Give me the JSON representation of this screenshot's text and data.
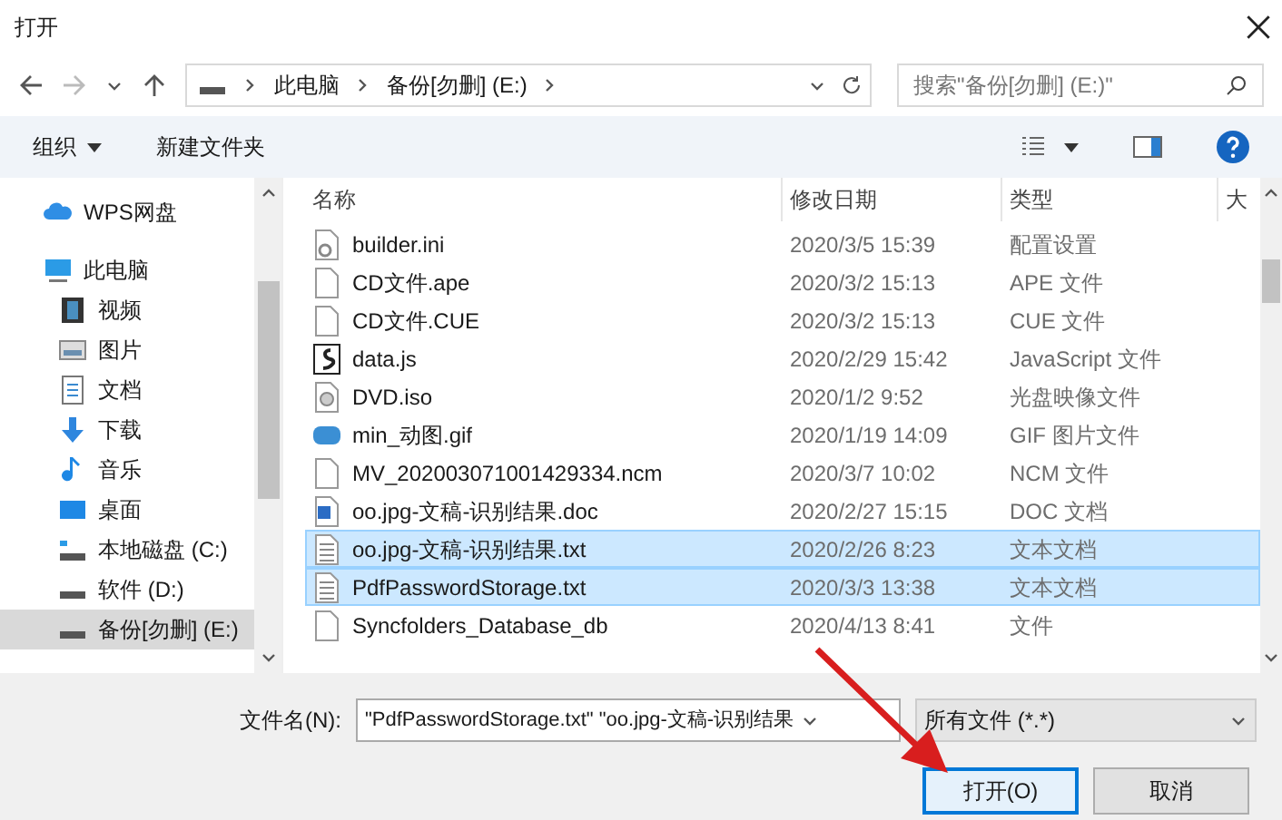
{
  "window": {
    "title": "打开"
  },
  "address": {
    "crumbs": [
      "此电脑",
      "备份[勿删] (E:)"
    ],
    "search_placeholder": "搜索\"备份[勿删] (E:)\""
  },
  "toolbar": {
    "organize": "组织",
    "new_folder": "新建文件夹"
  },
  "sidebar": {
    "items": [
      {
        "label": "WPS网盘",
        "kind": "cloud",
        "selected": false
      },
      {
        "label": "此电脑",
        "kind": "pc",
        "selected": false,
        "children": [
          {
            "label": "视频",
            "kind": "video",
            "selected": false
          },
          {
            "label": "图片",
            "kind": "picture",
            "selected": false
          },
          {
            "label": "文档",
            "kind": "doc",
            "selected": false
          },
          {
            "label": "下载",
            "kind": "download",
            "selected": false
          },
          {
            "label": "音乐",
            "kind": "music",
            "selected": false
          },
          {
            "label": "桌面",
            "kind": "desktop",
            "selected": false
          },
          {
            "label": "本地磁盘 (C:)",
            "kind": "sysdrive",
            "selected": false
          },
          {
            "label": "软件 (D:)",
            "kind": "drive",
            "selected": false
          },
          {
            "label": "备份[勿删] (E:)",
            "kind": "drive",
            "selected": true
          }
        ]
      }
    ]
  },
  "table": {
    "columns": [
      "名称",
      "修改日期",
      "类型",
      "大"
    ],
    "rows": [
      {
        "name": "builder.ini",
        "date": "2020/3/5 15:39",
        "type": "配置设置",
        "kind": "ini",
        "selected": false
      },
      {
        "name": "CD文件.ape",
        "date": "2020/3/2 15:13",
        "type": "APE 文件",
        "kind": "blank",
        "selected": false
      },
      {
        "name": "CD文件.CUE",
        "date": "2020/3/2 15:13",
        "type": "CUE 文件",
        "kind": "blank",
        "selected": false
      },
      {
        "name": "data.js",
        "date": "2020/2/29 15:42",
        "type": "JavaScript 文件",
        "kind": "js",
        "selected": false
      },
      {
        "name": "DVD.iso",
        "date": "2020/1/2 9:52",
        "type": "光盘映像文件",
        "kind": "iso",
        "selected": false
      },
      {
        "name": "min_动图.gif",
        "date": "2020/1/19 14:09",
        "type": "GIF 图片文件",
        "kind": "gif",
        "selected": false
      },
      {
        "name": "MV_202003071001429334.ncm",
        "date": "2020/3/7 10:02",
        "type": "NCM 文件",
        "kind": "blank",
        "selected": false
      },
      {
        "name": "oo.jpg-文稿-识别结果.doc",
        "date": "2020/2/27 15:15",
        "type": "DOC 文档",
        "kind": "doc",
        "selected": false
      },
      {
        "name": "oo.jpg-文稿-识别结果.txt",
        "date": "2020/2/26 8:23",
        "type": "文本文档",
        "kind": "txt",
        "selected": true
      },
      {
        "name": "PdfPasswordStorage.txt",
        "date": "2020/3/3 13:38",
        "type": "文本文档",
        "kind": "txt",
        "selected": true
      },
      {
        "name": "Syncfolders_Database_db",
        "date": "2020/4/13 8:41",
        "type": "文件",
        "kind": "blank",
        "selected": false
      }
    ]
  },
  "footer": {
    "filename_label": "文件名(N):",
    "filename_value": "\"PdfPasswordStorage.txt\" \"oo.jpg-文稿-识别结果",
    "filter": "所有文件 (*.*)",
    "open": "打开(O)",
    "cancel": "取消"
  }
}
